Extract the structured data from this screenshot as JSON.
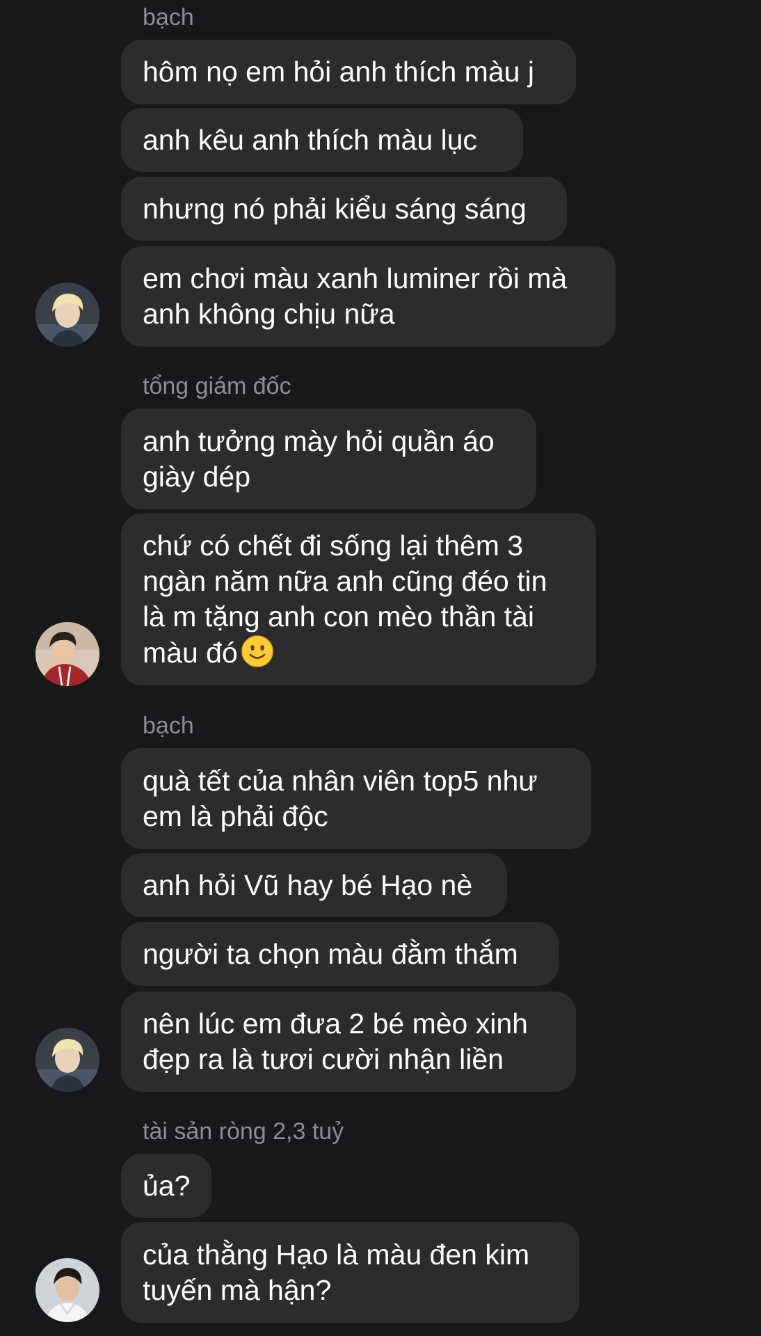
{
  "conversation": {
    "group1": {
      "sender": "bạch",
      "messages": [
        [
          "hôm nọ em hỏi anh thích màu j"
        ],
        [
          "anh kêu anh thích màu lục"
        ],
        [
          "nhưng nó phải kiểu sáng sáng"
        ],
        [
          "em chơi màu xanh luminer rồi mà",
          "anh không chịu nữa"
        ]
      ]
    },
    "group2": {
      "sender": "tổng giám đốc",
      "messages": [
        [
          "anh tưởng mày hỏi quần áo",
          "giày dép"
        ],
        [
          "chứ có chết đi sống lại thêm 3",
          "ngàn năm nữa anh cũng đéo tin",
          "là m tặng anh con mèo thần tài",
          "màu đó"
        ]
      ],
      "emoji": "slightly-smiling-face-icon"
    },
    "group3": {
      "sender": "bạch",
      "messages": [
        [
          "quà tết của nhân viên top5 như",
          "em là phải độc"
        ],
        [
          "anh hỏi Vũ hay bé Hạo nè"
        ],
        [
          "người ta chọn màu đằm thắm"
        ],
        [
          "nên lúc em đưa 2 bé mèo xinh",
          "đẹp ra là tươi cười nhận liền"
        ]
      ]
    },
    "group4": {
      "sender": "tài sản ròng 2,3 tuỷ",
      "messages": [
        [
          "ủa?"
        ],
        [
          "của thằng Hạo là màu đen kim",
          "tuyến mà hận?"
        ]
      ]
    }
  },
  "colors": {
    "background": "#18181a",
    "bubble": "#2c2c2e",
    "text": "#ffffff",
    "sender_name": "#8e8e93"
  }
}
